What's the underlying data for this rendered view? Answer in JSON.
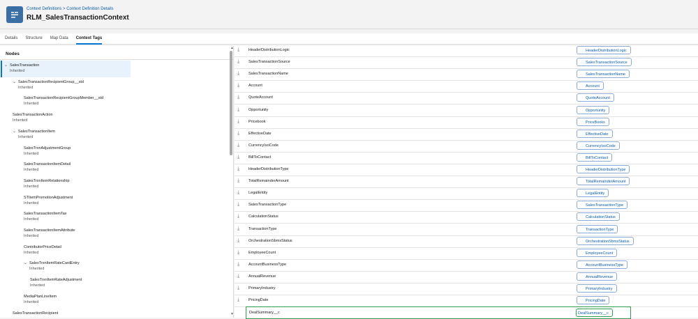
{
  "header": {
    "breadcrumb": "Context Definitions > Context Definition Details",
    "title": "RLM_SalesTransactionContext",
    "icon": "context-definition-icon"
  },
  "tabs": [
    "Details",
    "Structure",
    "Map Data",
    "Context Tags"
  ],
  "active_tab": "Context Tags",
  "nodes_panel": {
    "title": "Nodes",
    "items": [
      {
        "label": "SalesTransaction",
        "sub": "Inherited",
        "indent": 0,
        "chevron": true
      },
      {
        "label": "SalesTransactionRecipientGroup__std",
        "sub": "Inherited",
        "indent": 1,
        "chevron": true
      },
      {
        "label": "SalesTransactionRecipientGroupMember__std",
        "sub": "Inherited",
        "indent": 2,
        "chevron": false
      },
      {
        "label": "SalesTransactionAction",
        "sub": "Inherited",
        "indent": 1,
        "chevron": false
      },
      {
        "label": "SalesTransactionItem",
        "sub": "Inherited",
        "indent": 1,
        "chevron": true
      },
      {
        "label": "SalesTrxnAdjustmentGroup",
        "sub": "Inherited",
        "indent": 2,
        "chevron": false
      },
      {
        "label": "SalesTransactionItemDetail",
        "sub": "Inherited",
        "indent": 2,
        "chevron": false
      },
      {
        "label": "SalesTrxnItemRelationship",
        "sub": "Inherited",
        "indent": 2,
        "chevron": false
      },
      {
        "label": "STItemPromotionAdjustment",
        "sub": "Inherited",
        "indent": 2,
        "chevron": false
      },
      {
        "label": "SalesTransactionItemTax",
        "sub": "Inherited",
        "indent": 2,
        "chevron": false
      },
      {
        "label": "SalesTransactionItemAttribute",
        "sub": "Inherited",
        "indent": 2,
        "chevron": false
      },
      {
        "label": "ContributorPriceDetail",
        "sub": "Inherited",
        "indent": 2,
        "chevron": false
      },
      {
        "label": "SalesTrxnItemRateCardEntry",
        "sub": "Inherited",
        "indent": 2,
        "chevron": true
      },
      {
        "label": "SalesTrxnItemRateAdjustment",
        "sub": "Inherited",
        "indent": 3,
        "chevron": false
      },
      {
        "label": "MediaPlanLineItem",
        "sub": "Inherited",
        "indent": 2,
        "chevron": false
      },
      {
        "label": "SalesTransactionRecipient",
        "sub": "",
        "indent": 1,
        "chevron": false
      }
    ]
  },
  "tags": [
    {
      "name": "HeaderDistributionLogic",
      "tag": "HeaderDistributionLogic"
    },
    {
      "name": "SalesTransactionSource",
      "tag": "SalesTransactionSource"
    },
    {
      "name": "SalesTransactionName",
      "tag": "SalesTransactionName"
    },
    {
      "name": "Account",
      "tag": "Account"
    },
    {
      "name": "QuoteAccount",
      "tag": "QuoteAccount"
    },
    {
      "name": "Opportunity",
      "tag": "Opportunity"
    },
    {
      "name": "Pricebook",
      "tag": "PriceBooks"
    },
    {
      "name": "EffectiveDate",
      "tag": "EffectiveDate"
    },
    {
      "name": "CurrencyIsoCode",
      "tag": "CurrencyIsoCode"
    },
    {
      "name": "BillToContact",
      "tag": "BillToContact"
    },
    {
      "name": "HeaderDistributionType",
      "tag": "HeaderDistributionType"
    },
    {
      "name": "TotalRemainderAmount",
      "tag": "TotalRemainderAmount"
    },
    {
      "name": "LegalEntity",
      "tag": "LegalEntity"
    },
    {
      "name": "SalesTransactionType",
      "tag": "SalesTransactionType"
    },
    {
      "name": "CalculationStatus",
      "tag": "CalculationStatus"
    },
    {
      "name": "TransactionType",
      "tag": "TransactionType"
    },
    {
      "name": "OrchestrationSbmsStatus",
      "tag": "OrchestrationSbmsStatus"
    },
    {
      "name": "EmployeeCount",
      "tag": "EmployeeCount"
    },
    {
      "name": "AccountBusinessType",
      "tag": "AccountBusinessType"
    },
    {
      "name": "AnnualRevenue",
      "tag": "AnnualRevenue"
    },
    {
      "name": "PrimaryIndustry",
      "tag": "PrimaryIndustry"
    },
    {
      "name": "PricingDate",
      "tag": "PricingDate"
    },
    {
      "name": "DealSummary__c",
      "tag": "DealSummary__c",
      "highlight": true
    }
  ],
  "colors": {
    "accent": "#0176d3",
    "tag_text": "#0b5cab",
    "highlight": "#2e9e4e"
  }
}
